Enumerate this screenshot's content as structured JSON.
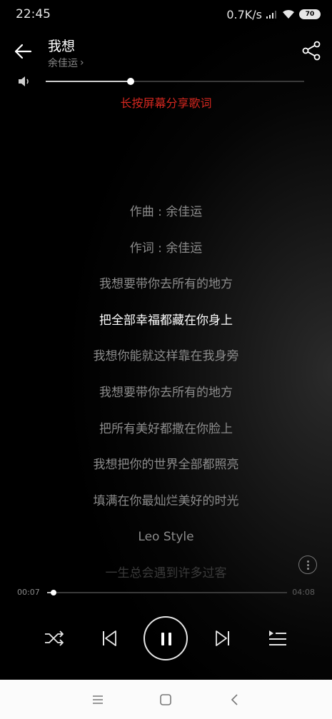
{
  "status_bar": {
    "time": "22:45",
    "net_speed": "0.7K/s",
    "battery": "70"
  },
  "header": {
    "title": "我想",
    "artist": "余佳运",
    "artist_chevron": "›"
  },
  "volume": {
    "level": 0.33
  },
  "share_hint": "长按屏幕分享歌词",
  "lyrics": [
    {
      "text": "作曲 : 余佳运",
      "state": "normal"
    },
    {
      "text": "作词 : 余佳运",
      "state": "normal"
    },
    {
      "text": "我想要带你去所有的地方",
      "state": "normal"
    },
    {
      "text": "把全部幸福都藏在你身上",
      "state": "current"
    },
    {
      "text": "我想你能就这样靠在我身旁",
      "state": "normal"
    },
    {
      "text": "我想要带你去所有的地方",
      "state": "normal"
    },
    {
      "text": "把所有美好都撒在你脸上",
      "state": "normal"
    },
    {
      "text": "我想把你的世界全部都照亮",
      "state": "normal"
    },
    {
      "text": "填满在你最灿烂美好的时光",
      "state": "normal"
    },
    {
      "text": "Leo Style",
      "state": "normal"
    },
    {
      "text": "一生总会遇到许多过客",
      "state": "faded"
    }
  ],
  "playback": {
    "elapsed": "00:07",
    "total": "04:08",
    "progress": 0.028
  },
  "icons": {
    "back": "back-arrow-icon",
    "share": "share-icon",
    "volume": "speaker-icon",
    "shuffle": "shuffle-icon",
    "previous": "previous-icon",
    "pause": "pause-icon",
    "next": "next-icon",
    "playlist": "playlist-icon",
    "more": "more-vertical-icon",
    "nav_menu": "menu-icon",
    "nav_home": "home-square-icon",
    "nav_back": "nav-back-icon"
  },
  "colors": {
    "accent": "#d5271f",
    "background": "#000000",
    "current_lyric": "#ffffff",
    "lyric": "#8c8c8c"
  }
}
